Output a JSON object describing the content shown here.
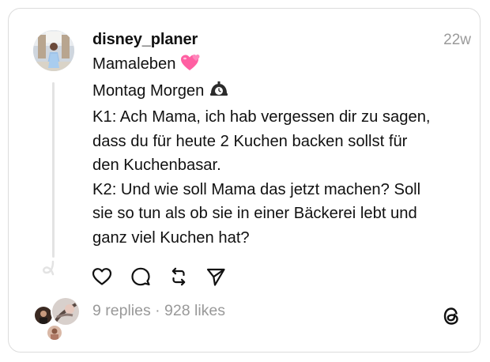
{
  "post": {
    "username": "disney_planer",
    "time": "22w",
    "lines": [
      "Mamaleben",
      "Montag Morgen",
      "K1: Ach Mama, ich hab vergessen dir zu sagen,",
      "dass du für heute 2 Kuchen backen sollst für",
      "den Kuchenbasar.",
      "K2: Und wie soll Mama das jetzt machen? Soll",
      "sie so tun als ob sie in einer Bäckerei lebt und",
      "ganz viel Kuchen hat?"
    ],
    "emojis": {
      "line1": "two-hearts-icon",
      "line2": "alarm-clock-icon"
    }
  },
  "stats": {
    "text": "9 replies · 928 likes"
  },
  "icons": {
    "like": "heart-icon",
    "reply": "comment-icon",
    "repost": "repost-icon",
    "share": "send-icon",
    "brand": "threads-logo-icon"
  },
  "colors": {
    "text": "#111111",
    "muted": "#999999",
    "border": "#dcdcdc",
    "heart_emoji": "#ff5fa2"
  }
}
